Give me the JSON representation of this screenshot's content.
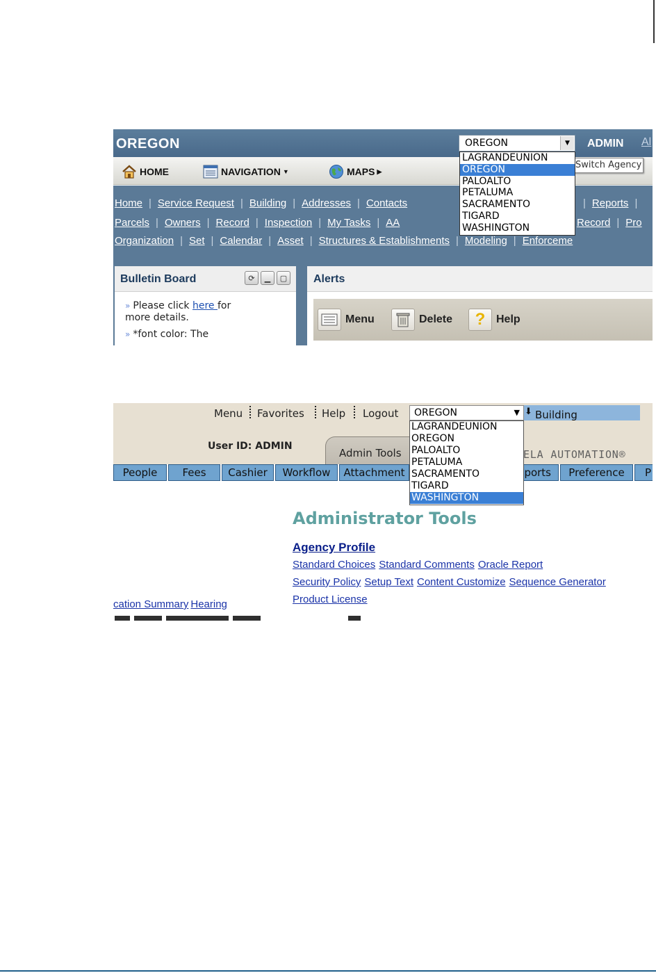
{
  "shot1": {
    "agency_title": "OREGON",
    "agency_select_value": "OREGON",
    "user_label": "ADMIN",
    "user_label_cut": "Al",
    "toolbar": {
      "home": "HOME",
      "navigation": "NAVIGATION",
      "maps": "MAPS"
    },
    "switch_agency_tooltip": "Switch Agency",
    "links_row1": [
      "Home",
      "Service Request",
      "Building",
      "Addresses",
      "Contacts",
      "Reports"
    ],
    "links_row2": [
      "Parcels",
      "Owners",
      "Record",
      "Inspection",
      "My Tasks",
      "AA",
      "Record",
      "Pro"
    ],
    "links_row3": [
      "Organization",
      "Set",
      "Calendar",
      "Asset",
      "Structures & Establishments",
      "Modeling",
      "Enforceme"
    ],
    "dropdown_options": [
      "LAGRANDEUNION",
      "OREGON",
      "PALOALTO",
      "PETALUMA",
      "SACRAMENTO",
      "TIGARD",
      "WASHINGTON"
    ],
    "dropdown_selected": "OREGON",
    "bulletin": {
      "title": "Bulletin Board",
      "line1_pre": "Please click ",
      "line1_link": "here ",
      "line1_post": "for",
      "line2": "more details.",
      "line3": "*font color: The"
    },
    "alerts": {
      "title": "Alerts",
      "menu": "Menu",
      "delete": "Delete",
      "help": "Help"
    }
  },
  "shot2": {
    "top_menu": [
      "Menu",
      "Favorites",
      "Help",
      "Logout"
    ],
    "agency_select_value": "OREGON",
    "module_label": "Building",
    "user_id": "User ID: ADMIN",
    "active_tab": "Admin Tools",
    "brand": "ELA AUTOMATION®",
    "nav_tabs": [
      "People",
      "Fees",
      "Cashier",
      "Workflow",
      "Attachment",
      "ports",
      "Preference",
      "P"
    ],
    "dropdown_options": [
      "LAGRANDEUNION",
      "OREGON",
      "PALOALTO",
      "PETALUMA",
      "SACRAMENTO",
      "TIGARD",
      "WASHINGTON"
    ],
    "dropdown_selected": "WASHINGTON",
    "page_title": "Administrator Tools",
    "section_title": "Agency Profile",
    "links_row1": [
      "Standard Choices",
      "Standard Comments",
      "Oracle Report"
    ],
    "links_row2": [
      "Security Policy",
      "Setup Text",
      "Content Customize",
      "Sequence Generator"
    ],
    "links_row3": [
      "Product License"
    ],
    "left_links": [
      "cation Summary",
      "Hearing"
    ]
  }
}
